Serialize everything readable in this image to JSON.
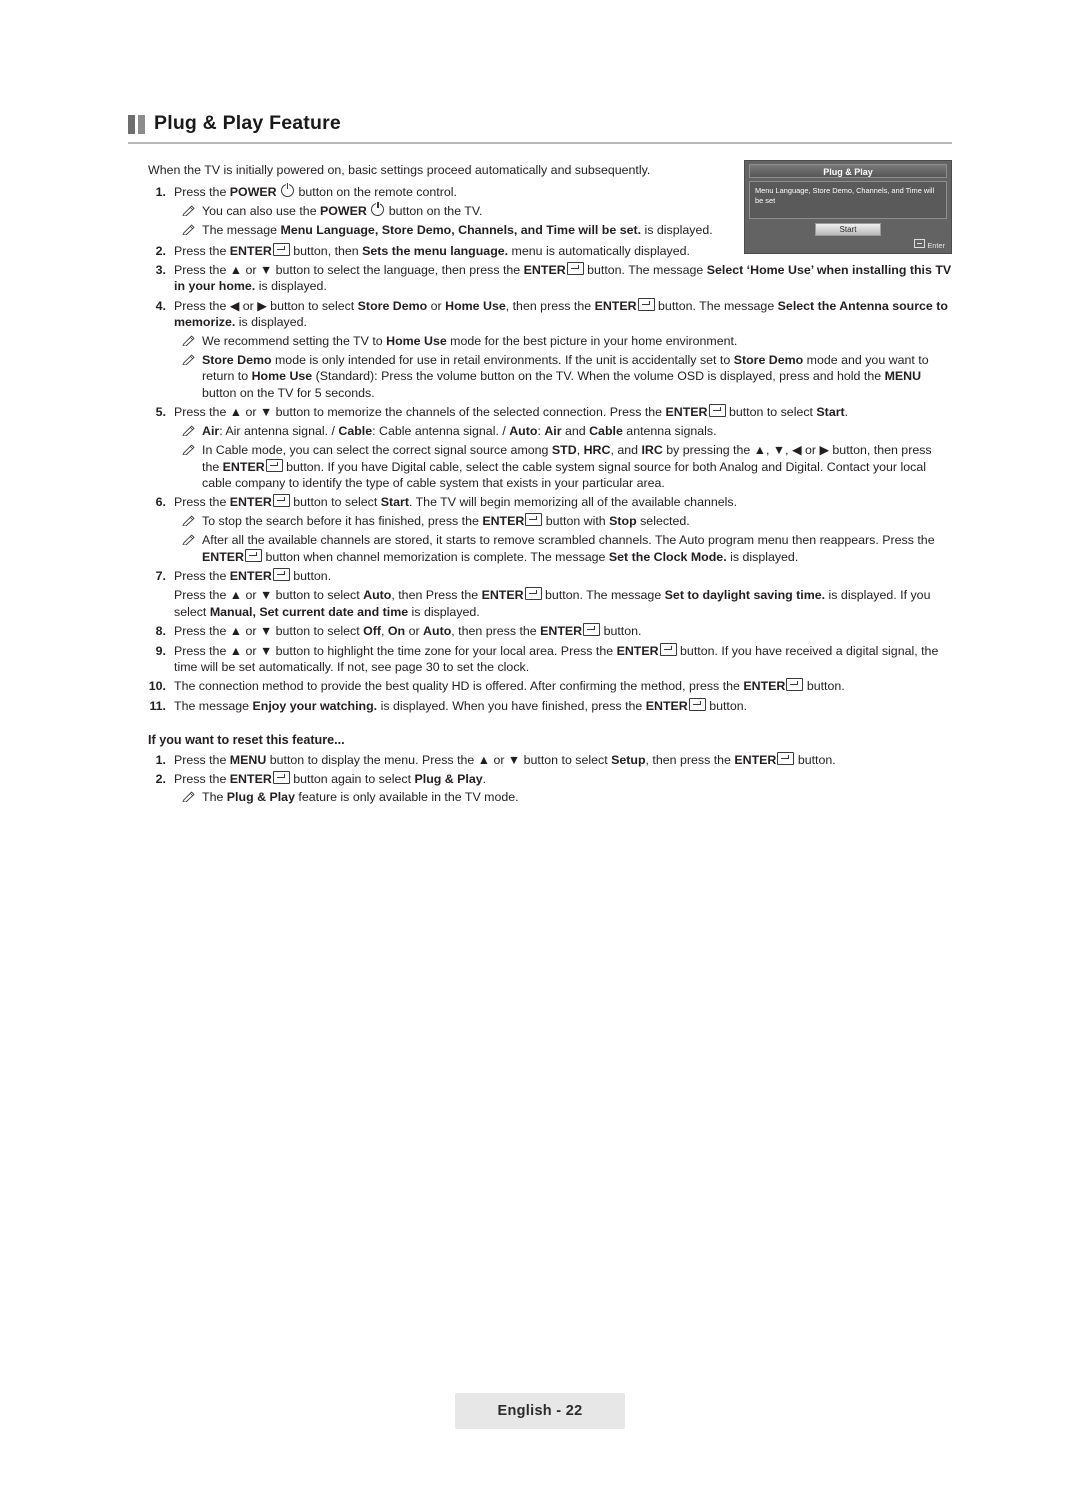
{
  "page": {
    "title": "Plug & Play Feature",
    "footer": "English - 22"
  },
  "intro": "When the TV is initially powered on, basic settings proceed automatically and subsequently.",
  "osd": {
    "title": "Plug & Play",
    "body": "Menu Language, Store Demo, Channels, and Time will be set",
    "start_button": "Start",
    "enter_label": "Enter"
  },
  "steps": [
    {
      "num": "1.",
      "html": "Press the <b>POWER</b> <span class=\"pow-ico\" data-name=\"power-icon\" data-interactable=\"false\"></span> button on the remote control."
    },
    {
      "num": "2.",
      "html": "Press the <b>ENTER</b><span class=\"enter-ico\" data-name=\"enter-icon\" data-interactable=\"false\"></span> button, then <b>Sets the menu language.</b> menu is automatically displayed."
    },
    {
      "num": "3.",
      "html": "Press the ▲ or ▼ button to select the language, then press the <b>ENTER</b><span class=\"enter-ico\" data-name=\"enter-icon\" data-interactable=\"false\"></span> button. The message <b>Select ‘Home Use’ when installing this TV in your home.</b> is displayed."
    },
    {
      "num": "4.",
      "html": "Press the ◀ or ▶ button to select <b>Store Demo</b> or <b>Home Use</b>, then press the <b>ENTER</b><span class=\"enter-ico\" data-name=\"enter-icon\" data-interactable=\"false\"></span> button. The message <b>Select the Antenna source to memorize.</b> is displayed."
    },
    {
      "num": "5.",
      "html": "Press the ▲ or ▼ button to memorize the channels of the selected connection. Press the <b>ENTER</b><span class=\"enter-ico\" data-name=\"enter-icon\" data-interactable=\"false\"></span> button to select <b>Start</b>."
    },
    {
      "num": "6.",
      "html": "Press the <b>ENTER</b><span class=\"enter-ico\" data-name=\"enter-icon\" data-interactable=\"false\"></span> button to select <b>Start</b>. The TV will begin memorizing all of the available channels."
    },
    {
      "num": "7.",
      "html": "Press the <b>ENTER</b><span class=\"enter-ico\" data-name=\"enter-icon\" data-interactable=\"false\"></span> button."
    },
    {
      "num": "8.",
      "html": "Press the ▲ or ▼ button to select <b>Off</b>, <b>On</b> or <b>Auto</b>, then press the <b>ENTER</b><span class=\"enter-ico\" data-name=\"enter-icon\" data-interactable=\"false\"></span> button."
    },
    {
      "num": "9.",
      "html": "Press the ▲ or ▼ button to highlight the time zone for your local area. Press the <b>ENTER</b><span class=\"enter-ico\" data-name=\"enter-icon\" data-interactable=\"false\"></span> button. If you have received a digital signal, the time will be set automatically. If not, see page 30 to set the clock."
    },
    {
      "num": "10.",
      "html": "The connection method to provide the best quality HD is offered. After confirming the method, press the <b>ENTER</b><span class=\"enter-ico\" data-name=\"enter-icon\" data-interactable=\"false\"></span> button."
    },
    {
      "num": "11.",
      "html": "The message <b>Enjoy your watching.</b> is displayed. When you have finished, press the <b>ENTER</b><span class=\"enter-ico\" data-name=\"enter-icon\" data-interactable=\"false\"></span> button."
    }
  ],
  "notes": {
    "step1_a": "You can also use the <b>POWER</b> <span class=\"pow-ico\" data-name=\"power-icon\" data-interactable=\"false\"></span> button on the TV.",
    "step1_b": "The message <b>Menu Language, Store Demo, Channels, and Time will be set.</b> is displayed.",
    "step4_a": "We recommend setting the TV to <b>Home Use</b> mode for the best picture in your home environment.",
    "step4_b": "<b>Store Demo</b> mode is only intended for use in retail environments. If the unit is accidentally set to <b>Store Demo</b> mode and you want to return to <b>Home Use</b> (Standard): Press the volume button on the TV. When the volume OSD is displayed, press and hold the <b>MENU</b> button on the TV for 5 seconds.",
    "step5_a": "<b>Air</b>: Air antenna signal. / <b>Cable</b>: Cable antenna signal. / <b>Auto</b>: <b>Air</b> and <b>Cable</b> antenna signals.",
    "step5_b": "In Cable mode, you can select the correct signal source among <b>STD</b>, <b>HRC</b>, and <b>IRC</b> by pressing the ▲, ▼, ◀ or ▶ button, then press the <b>ENTER</b><span class=\"enter-ico\" data-name=\"enter-icon\" data-interactable=\"false\"></span> button. If you have Digital cable, select the cable system signal source for both Analog and Digital. Contact your local cable company to identify the type of cable system that exists in your particular area.",
    "step6_a": "To stop the search before it has finished, press the <b>ENTER</b><span class=\"enter-ico\" data-name=\"enter-icon\" data-interactable=\"false\"></span> button with <b>Stop</b> selected.",
    "step6_b": "After all the available channels are stored, it starts to remove scrambled channels. The Auto program menu then reappears. Press the <b>ENTER</b><span class=\"enter-ico\" data-name=\"enter-icon\" data-interactable=\"false\"></span> button when channel memorization is complete. The message <b>Set the Clock Mode.</b> is displayed.",
    "step7_body": "Press the ▲ or ▼ button to select <b>Auto</b>, then Press the <b>ENTER</b><span class=\"enter-ico\" data-name=\"enter-icon\" data-interactable=\"false\"></span> button. The message <b>Set to daylight saving time.</b> is displayed. If you select <b>Manual, Set current date and time</b> is displayed.",
    "reset_note": "The <b>Plug &amp; Play</b> feature is only available in the TV mode."
  },
  "reset_section": {
    "heading": "If you want to reset this feature...",
    "steps": [
      {
        "num": "1.",
        "html": "Press the <b>MENU</b> button to display the menu. Press the ▲ or ▼ button to select <b>Setup</b>, then press the <b>ENTER</b><span class=\"enter-ico\" data-name=\"enter-icon\" data-interactable=\"false\"></span> button."
      },
      {
        "num": "2.",
        "html": "Press the <b>ENTER</b><span class=\"enter-ico\" data-name=\"enter-icon\" data-interactable=\"false\"></span> button again to select <b>Plug &amp; Play</b>."
      }
    ]
  }
}
